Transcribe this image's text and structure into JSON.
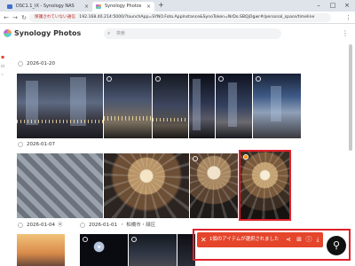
{
  "browser": {
    "tabs": [
      {
        "label": "DSC1.1_IX - Synology NAS"
      },
      {
        "label": "Synology Photos"
      }
    ],
    "url_warning": "保護されていない通信",
    "url": "192.168.40.214:5000/?launchApp=SYNO.Foto.AppInstance&SynoToken=NrDo.SBQjOgwr#/personal_space/timeline"
  },
  "app": {
    "title": "Synology Photos",
    "search_placeholder": "検索"
  },
  "timeline": {
    "groups": [
      {
        "date": "2026-01-20"
      },
      {
        "date": "2026-01-07"
      },
      {
        "date": "2026-01-04",
        "separator": "・",
        "date2": "2026-01-01",
        "location": "・ 柏橋市・緑区"
      }
    ]
  },
  "selection": {
    "text": "1個のアイテムが選択されました",
    "count": 1
  },
  "colors": {
    "selection_bar": "#e4452b",
    "highlight": "#e0202a"
  }
}
